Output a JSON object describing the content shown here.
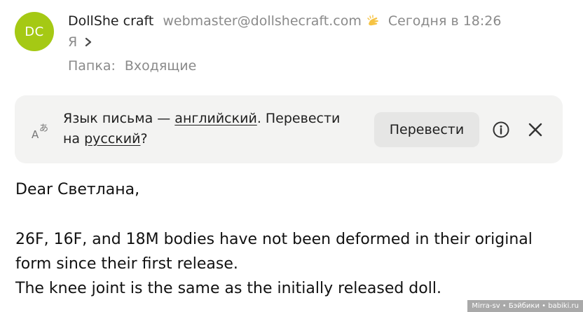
{
  "sender": {
    "initials": "DC",
    "avatar_color": "#a5c914",
    "name": "DollShe craft",
    "email": "webmaster@dollshecraft.com",
    "email_icon": "waving-hand-icon",
    "date": "Сегодня в 18:26"
  },
  "recipient": {
    "label": "Я"
  },
  "folder": {
    "label": "Папка:",
    "value": "Входящие"
  },
  "translate": {
    "text_prefix": "Язык письма — ",
    "source_language": "английский",
    "text_middle": ". Перевести на ",
    "target_language": "русский",
    "text_suffix": "?",
    "button_label": "Перевести"
  },
  "message": {
    "greeting": "Dear Светлана,",
    "paragraph1_line1": "26F, 16F, and 18M bodies have not been deformed in their original form since their first release.",
    "paragraph1_line2": "The knee joint is the same as the initially released doll."
  },
  "watermark": "Mirra-sv • Бэйбики • babiki.ru"
}
